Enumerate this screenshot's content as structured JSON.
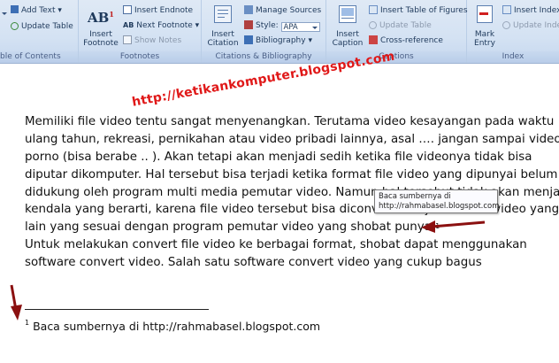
{
  "ribbon": {
    "toc": {
      "add_text": "Add Text",
      "update_table": "Update Table",
      "group_label": "ble of Contents"
    },
    "footnotes": {
      "insert_footnote": "Insert\nFootnote",
      "insert_endnote": "Insert Endnote",
      "next_footnote": "Next Footnote",
      "show_notes": "Show Notes",
      "ab_glyph": "AB",
      "group_label": "Footnotes"
    },
    "citations": {
      "insert_citation": "Insert\nCitation",
      "manage_sources": "Manage Sources",
      "style_label": "Style:",
      "style_value": "APA",
      "bibliography": "Bibliography",
      "group_label": "Citations & Bibliography"
    },
    "captions": {
      "insert_caption": "Insert\nCaption",
      "insert_table_of_figures": "Insert Table of Figures",
      "update_table": "Update Table",
      "cross_reference": "Cross-reference",
      "group_label": "Captions"
    },
    "index": {
      "mark_entry": "Mark\nEntry",
      "insert_index": "Insert Index",
      "update_index": "Update Inde",
      "group_label": "Index"
    }
  },
  "document": {
    "watermark": "http://ketikankomputer.blogspot.com",
    "paragraph1": [
      "Memiliki file video tentu sangat menyenangkan. Terutama video kesayangan pada waktu",
      "ulang tahun, rekreasi, pernikahan atau video pribadi lainnya, asal …. jangan sampai video",
      "porno (bisa berabe .. ). Akan tetapi akan menjadi sedih ketika file videonya tidak bisa",
      "diputar dikomputer.  Hal tersebut bisa terjadi ketika format file video yang dipunyai belum",
      "didukung oleh program multi media pemutar video. Namun hal tersebut tidak akan menjadi",
      "kendala yang berarti, karena file video tersebut bisa diconvert menjadi format video yang",
      "lain yang sesuai dengan program pemutar video yang shobat punya."
    ],
    "footnote_ref": "1",
    "paragraph2": [
      "Untuk melakukan convert file video ke berbagai format, shobat dapat menggunakan",
      "software convert video. Salah satu software convert video yang cukup bagus"
    ],
    "tooltip": [
      "Baca sumbernya di",
      "http://rahmabasel.blogspot.com"
    ],
    "footnote": {
      "number": "1",
      "text": "Baca sumbernya di http://rahmabasel.blogspot.com"
    }
  },
  "colors": {
    "ribbon_bg": "#d4e2f3",
    "watermark": "#e01818",
    "arrow": "#8b1010",
    "spell_squiggle": "#e00000"
  }
}
